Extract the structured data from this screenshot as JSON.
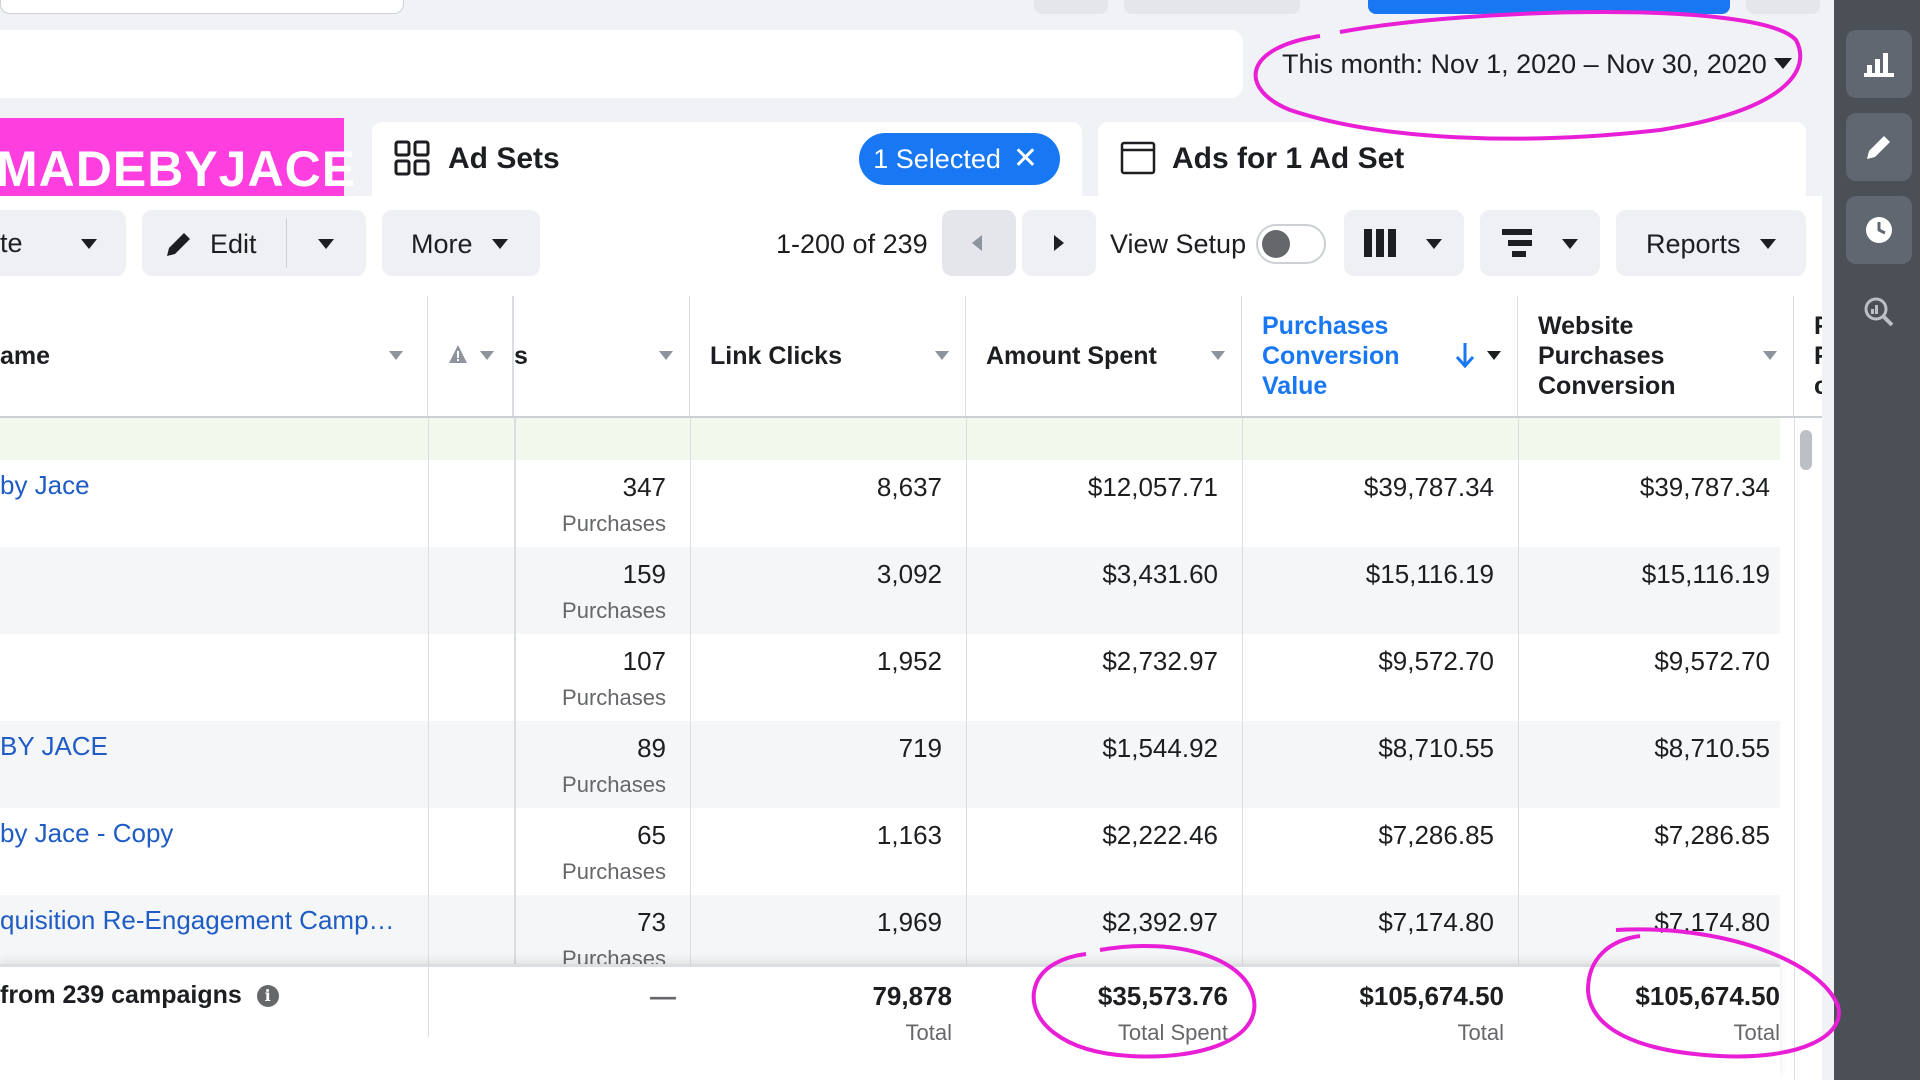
{
  "date_range": {
    "label": "This month: Nov 1, 2020 – Nov 30, 2020"
  },
  "brand": {
    "text": "MADEBYJACE"
  },
  "tabs": {
    "ad_sets": {
      "label": "Ad Sets",
      "selected_chip": "1 Selected",
      "close_glyph": "✕"
    },
    "ads": {
      "label": "Ads for 1 Ad Set"
    }
  },
  "toolbar": {
    "duplicate_partial": "te",
    "edit_label": "Edit",
    "more_label": "More",
    "pagination": "1-200 of 239",
    "view_setup_label": "View Setup",
    "reports_label": "Reports"
  },
  "table": {
    "columns": {
      "name": "ame",
      "results_partial": "s",
      "link_clicks": "Link Clicks",
      "amount_spent": "Amount Spent",
      "purchases_conversion_value": "Purchases Conversion Value",
      "website_purchases_conversion": "Website Purchases Conversion",
      "next_partial": "F F c"
    },
    "rows": [
      {
        "name": "by Jace",
        "results": "347",
        "results_sub": "Purchases",
        "link_clicks": "8,637",
        "amount_spent": "$12,057.71",
        "pcv": "$39,787.34",
        "wpc": "$39,787.34"
      },
      {
        "name": "",
        "results": "159",
        "results_sub": "Purchases",
        "link_clicks": "3,092",
        "amount_spent": "$3,431.60",
        "pcv": "$15,116.19",
        "wpc": "$15,116.19"
      },
      {
        "name": "",
        "results": "107",
        "results_sub": "Purchases",
        "link_clicks": "1,952",
        "amount_spent": "$2,732.97",
        "pcv": "$9,572.70",
        "wpc": "$9,572.70"
      },
      {
        "name": "BY JACE",
        "results": "89",
        "results_sub": "Purchases",
        "link_clicks": "719",
        "amount_spent": "$1,544.92",
        "pcv": "$8,710.55",
        "wpc": "$8,710.55"
      },
      {
        "name": "by Jace - Copy",
        "results": "65",
        "results_sub": "Purchases",
        "link_clicks": "1,163",
        "amount_spent": "$2,222.46",
        "pcv": "$7,286.85",
        "wpc": "$7,286.85"
      },
      {
        "name": "quisition Re-Engagement Camp…",
        "results": "73",
        "results_sub": "Purchases",
        "link_clicks": "1,969",
        "amount_spent": "$2,392.97",
        "pcv": "$7,174.80",
        "wpc": "$7,174.80"
      }
    ],
    "totals": {
      "label": "from 239 campaigns",
      "results": "—",
      "link_clicks": "79,878",
      "link_clicks_sub": "Total",
      "amount_spent": "$35,573.76",
      "amount_spent_sub": "Total Spent",
      "pcv": "$105,674.50",
      "pcv_sub": "Total",
      "wpc": "$105,674.50",
      "wpc_sub": "Total"
    }
  },
  "right_rail": {
    "icons": [
      "bar-chart-icon",
      "pencil-icon",
      "clock-icon",
      "search-chart-icon"
    ]
  },
  "colors": {
    "accent": "#1877f2",
    "brand_pink": "#ff3ee0",
    "annotation": "#e81fd6",
    "rail": "#4b4f56"
  }
}
